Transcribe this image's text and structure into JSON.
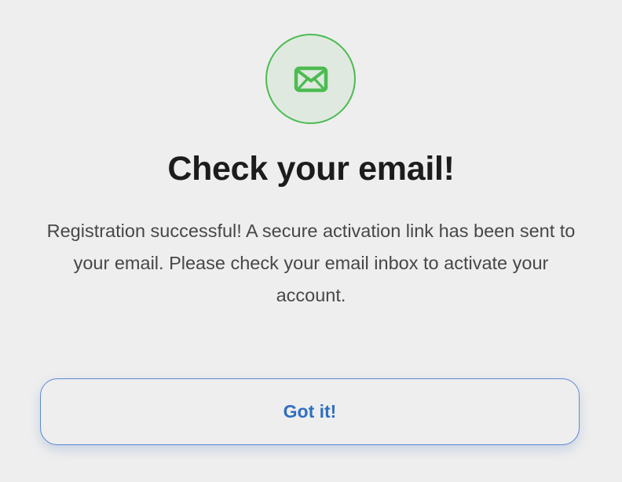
{
  "dialog": {
    "icon": "envelope-icon",
    "accent_color": "#4cbb52",
    "title": "Check your email!",
    "message": "Registration successful! A secure activation link has been sent to your email. Please check your email inbox to activate your account.",
    "button_label": "Got it!",
    "button_color": "#2f6fc0"
  }
}
